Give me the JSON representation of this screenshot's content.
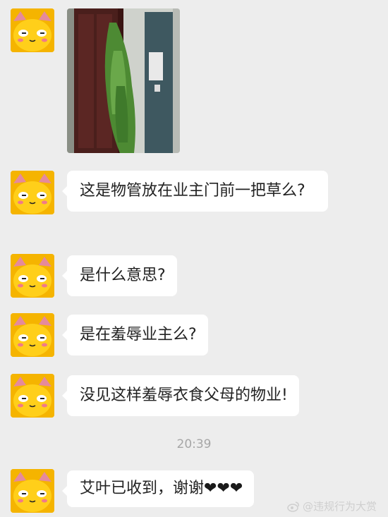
{
  "messages": [
    {
      "type": "image",
      "avatar": "cat-avatar"
    },
    {
      "type": "text",
      "text": "这是物管放在业主门前一把草么?"
    },
    {
      "type": "text",
      "text": "是什么意思?"
    },
    {
      "type": "text",
      "text": "是在羞辱业主么?"
    },
    {
      "type": "text",
      "text": "没见这样羞辱衣食父母的物业!"
    },
    {
      "type": "text",
      "text": "艾叶已收到，谢谢"
    }
  ],
  "timestamp": "20:39",
  "hearts": "❤❤❤",
  "watermark": "@违规行为大赏",
  "colors": {
    "background": "#ededed",
    "bubble": "#ffffff",
    "avatar": "#f5b400"
  }
}
